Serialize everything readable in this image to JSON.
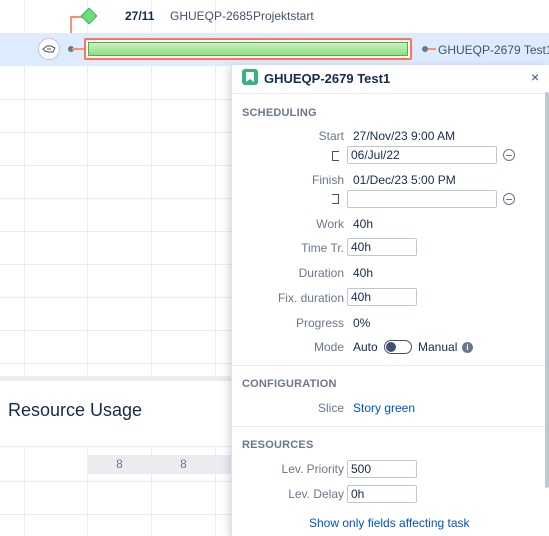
{
  "gantt": {
    "milestone": {
      "date": "27/11",
      "key": "GHUEQP-2685",
      "name": "Projektstart"
    },
    "task": {
      "label_after": "GHUEQP-2679  Test1"
    }
  },
  "resource_usage": {
    "title": "Resource Usage",
    "cells": [
      "8",
      "8"
    ]
  },
  "panel": {
    "title": "GHUEQP-2679 Test1",
    "close": "×",
    "sections": {
      "scheduling": "SCHEDULING",
      "configuration": "CONFIGURATION",
      "resources": "RESOURCES"
    },
    "fields": {
      "start_label": "Start",
      "start_value": "27/Nov/23 9:00 AM",
      "start_constraint": "06/Jul/22",
      "finish_label": "Finish",
      "finish_value": "01/Dec/23 5:00 PM",
      "finish_constraint": "",
      "work_label": "Work",
      "work_value": "40h",
      "timetr_label": "Time Tr.",
      "timetr_value": "40h",
      "duration_label": "Duration",
      "duration_value": "40h",
      "fixduration_label": "Fix. duration",
      "fixduration_value": "40h",
      "progress_label": "Progress",
      "progress_value": "0%",
      "mode_label": "Mode",
      "mode_auto": "Auto",
      "mode_manual": "Manual",
      "slice_label": "Slice",
      "slice_value": "Story green",
      "levpriority_label": "Lev. Priority",
      "levpriority_value": "500",
      "levdelay_label": "Lev. Delay",
      "levdelay_value": "0h"
    },
    "footer_link": "Show only fields affecting task"
  },
  "colors": {
    "accent": "#0052cc",
    "task_bar": "#8fdc84",
    "dependency": "#ff7452",
    "story": "#36b37e"
  },
  "icons": [
    "milestone-diamond-icon",
    "assign-hand-icon",
    "story-icon",
    "close-icon",
    "constraint-start-icon",
    "constraint-finish-icon",
    "remove-icon",
    "info-icon"
  ]
}
